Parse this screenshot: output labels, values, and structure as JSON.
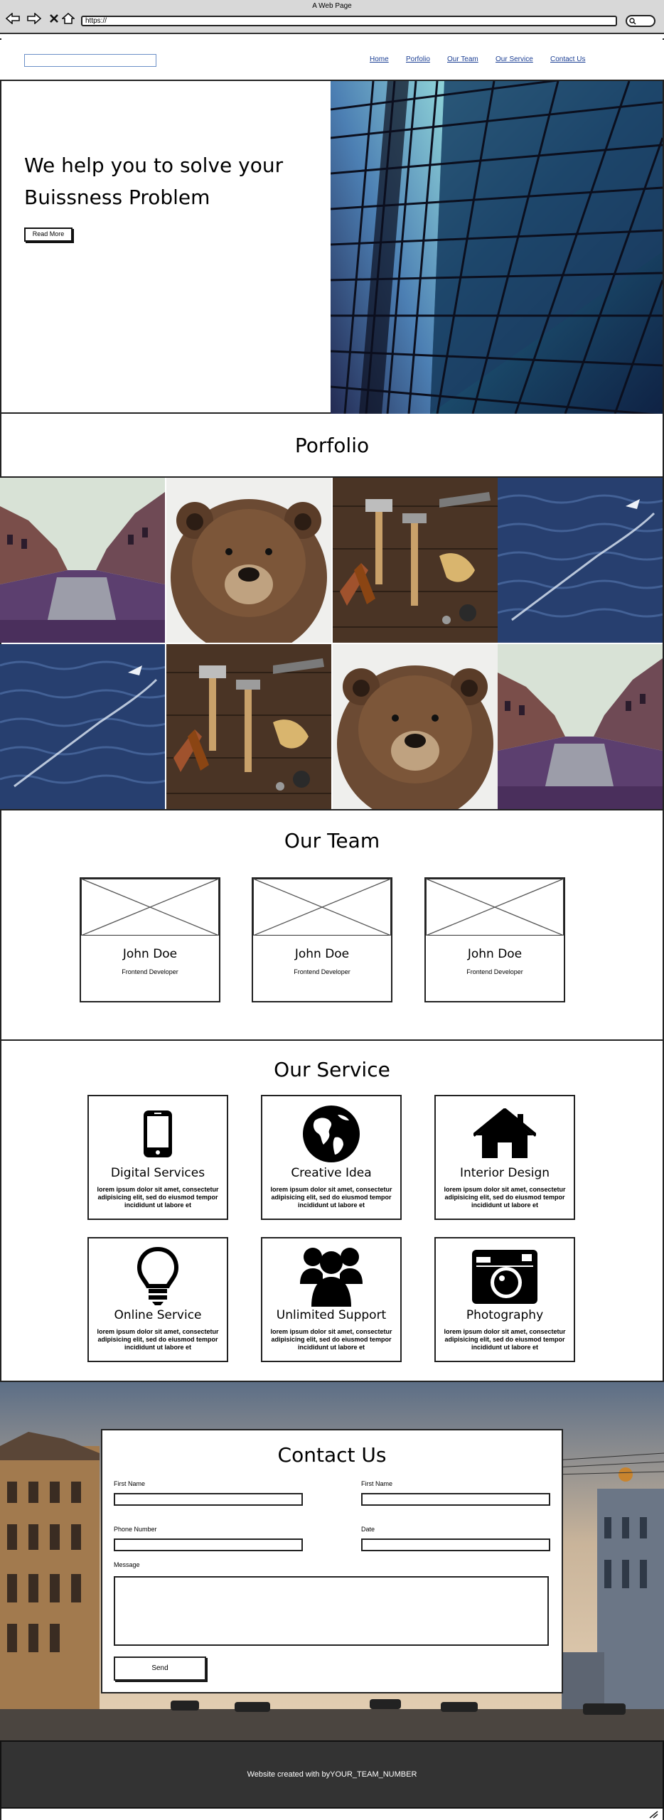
{
  "browser": {
    "window_title": "A Web Page",
    "url": "https://"
  },
  "nav": {
    "links": [
      "Home",
      "Porfolio",
      "Our Team",
      "Our Service",
      "Contact Us"
    ],
    "link_color": "#1c3f94"
  },
  "hero": {
    "title": "We help you to solve your Buissness Problem",
    "button_label": "Read More"
  },
  "portfolio": {
    "title": "Porfolio",
    "tiles": [
      "canal-city",
      "bear",
      "tools",
      "ocean",
      "ocean",
      "tools",
      "bear",
      "canal-city"
    ]
  },
  "team": {
    "title": "Our Team",
    "members": [
      {
        "name": "John Doe",
        "role": "Frontend Developer"
      },
      {
        "name": "John Doe",
        "role": "Frontend Developer"
      },
      {
        "name": "John Doe",
        "role": "Frontend Developer"
      }
    ]
  },
  "service": {
    "title": "Our Service",
    "items": [
      {
        "icon": "mobile-phone-icon",
        "name": "Digital Services",
        "text": "lorem ipsum dolor sit amet, consectetur adipisicing elit, sed do eiusmod tempor incididunt ut labore et"
      },
      {
        "icon": "globe-icon",
        "name": "Creative Idea",
        "text": "lorem ipsum dolor sit amet, consectetur adipisicing elit, sed do eiusmod tempor incididunt ut labore et"
      },
      {
        "icon": "house-icon",
        "name": "Interior Design",
        "text": "lorem ipsum dolor sit amet, consectetur adipisicing elit, sed do eiusmod tempor incididunt ut labore et"
      },
      {
        "icon": "lightbulb-icon",
        "name": "Online Service",
        "text": "lorem ipsum dolor sit amet, consectetur adipisicing elit, sed do eiusmod tempor incididunt ut labore et"
      },
      {
        "icon": "users-group-icon",
        "name": "Unlimited Support",
        "text": "lorem ipsum dolor sit amet, consectetur adipisicing elit, sed do eiusmod tempor incididunt ut labore et"
      },
      {
        "icon": "camera-icon",
        "name": "Photography",
        "text": "lorem ipsum dolor sit amet, consectetur adipisicing elit, sed do eiusmod tempor incididunt ut labore et"
      }
    ]
  },
  "contact": {
    "title": "Contact Us",
    "fields": {
      "first_name_1": "First Name",
      "first_name_2": "First Name",
      "phone": "Phone Number",
      "date": "Date",
      "message": "Message"
    },
    "send_label": "Send"
  },
  "footer": {
    "text": "Website created with byYOUR_TEAM_NUMBER",
    "background": "#333333"
  }
}
